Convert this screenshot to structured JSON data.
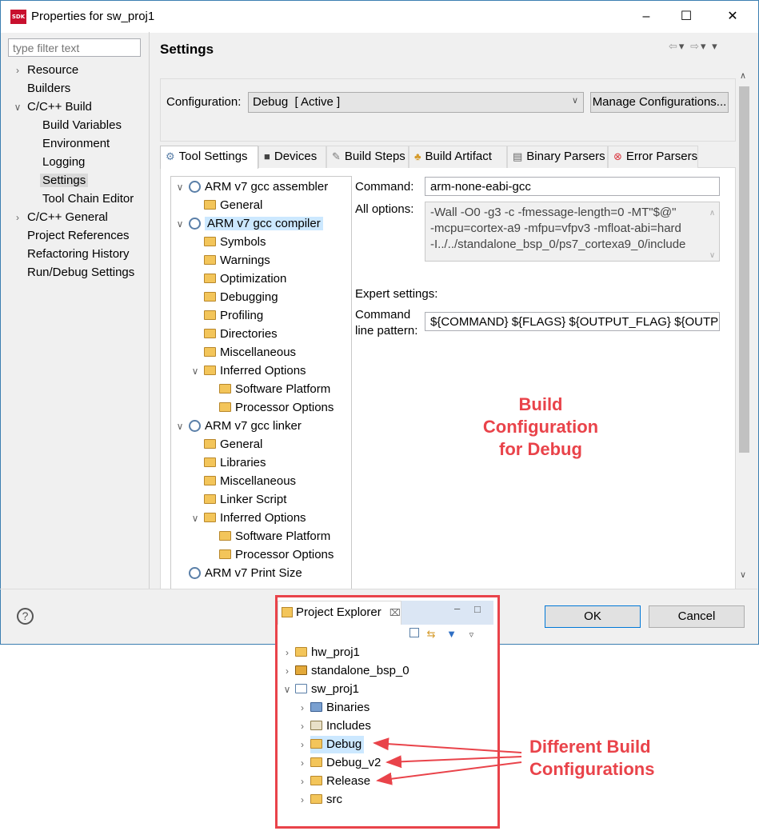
{
  "window": {
    "title": "Properties for sw_proj1",
    "icon_text": "SDK",
    "controls": [
      "minimize-icon",
      "maximize-icon",
      "close-icon"
    ]
  },
  "filter": {
    "placeholder": "type filter text"
  },
  "left_tree": [
    {
      "label": "Resource",
      "expander": "collapsed"
    },
    {
      "label": "Builders",
      "expander": "none"
    },
    {
      "label": "C/C++ Build",
      "expander": "expanded"
    },
    {
      "label": "Build Variables",
      "expander": "none"
    },
    {
      "label": "Environment",
      "expander": "none"
    },
    {
      "label": "Logging",
      "expander": "none"
    },
    {
      "label": "Settings",
      "expander": "none",
      "selected": true
    },
    {
      "label": "Tool Chain Editor",
      "expander": "none"
    },
    {
      "label": "C/C++ General",
      "expander": "collapsed"
    },
    {
      "label": "Project References",
      "expander": "none"
    },
    {
      "label": "Refactoring History",
      "expander": "none"
    },
    {
      "label": "Run/Debug Settings",
      "expander": "none"
    }
  ],
  "page": {
    "title": "Settings",
    "nav_icons": [
      "back-arrow-icon",
      "dropdown-icon",
      "forward-arrow-icon",
      "dropdown-icon",
      "view-menu-icon"
    ]
  },
  "configuration": {
    "label": "Configuration:",
    "value": "Debug  [ Active ]",
    "manage_button": "Manage Configurations..."
  },
  "tabs": [
    {
      "label": "Tool Settings",
      "icon": "tool-settings-icon",
      "active": true
    },
    {
      "label": "Devices",
      "icon": "devices-icon"
    },
    {
      "label": "Build Steps",
      "icon": "build-steps-icon"
    },
    {
      "label": "Build Artifact",
      "icon": "build-artifact-icon"
    },
    {
      "label": "Binary Parsers",
      "icon": "binary-parsers-icon"
    },
    {
      "label": "Error Parsers",
      "icon": "error-parsers-icon"
    }
  ],
  "tool_tree": [
    {
      "label": "ARM v7 gcc assembler",
      "icon": "tool-icon",
      "expander": "expanded"
    },
    {
      "label": "General",
      "icon": "options-folder-icon"
    },
    {
      "label": "ARM v7 gcc compiler",
      "icon": "tool-icon",
      "expander": "expanded",
      "selected": true
    },
    {
      "label": "Symbols",
      "icon": "options-folder-icon"
    },
    {
      "label": "Warnings",
      "icon": "options-folder-icon"
    },
    {
      "label": "Optimization",
      "icon": "options-folder-icon"
    },
    {
      "label": "Debugging",
      "icon": "options-folder-icon"
    },
    {
      "label": "Profiling",
      "icon": "options-folder-icon"
    },
    {
      "label": "Directories",
      "icon": "options-folder-icon"
    },
    {
      "label": "Miscellaneous",
      "icon": "options-folder-icon"
    },
    {
      "label": "Inferred Options",
      "icon": "options-folder-icon",
      "expander": "expanded"
    },
    {
      "label": "Software Platform",
      "icon": "options-folder-icon"
    },
    {
      "label": "Processor Options",
      "icon": "options-folder-icon"
    },
    {
      "label": "ARM v7 gcc linker",
      "icon": "tool-icon",
      "expander": "expanded"
    },
    {
      "label": "General",
      "icon": "options-folder-icon"
    },
    {
      "label": "Libraries",
      "icon": "options-folder-icon"
    },
    {
      "label": "Miscellaneous",
      "icon": "options-folder-icon"
    },
    {
      "label": "Linker Script",
      "icon": "options-folder-icon"
    },
    {
      "label": "Inferred Options",
      "icon": "options-folder-icon",
      "expander": "expanded"
    },
    {
      "label": "Software Platform",
      "icon": "options-folder-icon"
    },
    {
      "label": "Processor Options",
      "icon": "options-folder-icon"
    },
    {
      "label": "ARM v7 Print Size",
      "icon": "tool-icon"
    }
  ],
  "command": {
    "label": "Command:",
    "value": "arm-none-eabi-gcc"
  },
  "all_options": {
    "label": "All options:",
    "lines": [
      "-Wall -O0 -g3 -c -fmessage-length=0 -MT\"$@\"",
      "-mcpu=cortex-a9 -mfpu=vfpv3 -mfloat-abi=hard",
      "-I../../standalone_bsp_0/ps7_cortexa9_0/include"
    ]
  },
  "expert": {
    "heading": "Expert settings:",
    "pattern_label_1": "Command",
    "pattern_label_2": "line pattern:",
    "pattern_value": "${COMMAND} ${FLAGS} ${OUTPUT_FLAG} ${OUTPUT_P"
  },
  "annotation_debug": [
    "Build",
    "Configuration",
    "for Debug"
  ],
  "dialog_buttons": {
    "ok": "OK",
    "cancel": "Cancel"
  },
  "project_explorer": {
    "tab_label": "Project Explorer",
    "items": [
      {
        "label": "hw_proj1",
        "icon": "hw-project-icon",
        "expander": "collapsed"
      },
      {
        "label": "standalone_bsp_0",
        "icon": "bsp-project-icon",
        "expander": "collapsed"
      },
      {
        "label": "sw_proj1",
        "icon": "c-project-icon",
        "expander": "expanded"
      },
      {
        "label": "Binaries",
        "icon": "binaries-icon",
        "expander": "collapsed"
      },
      {
        "label": "Includes",
        "icon": "includes-icon",
        "expander": "collapsed"
      },
      {
        "label": "Debug",
        "icon": "folder-icon",
        "expander": "collapsed",
        "selected": true
      },
      {
        "label": "Debug_v2",
        "icon": "folder-icon",
        "expander": "collapsed"
      },
      {
        "label": "Release",
        "icon": "folder-icon",
        "expander": "collapsed"
      },
      {
        "label": "src",
        "icon": "folder-icon",
        "expander": "collapsed"
      }
    ]
  },
  "annotation_configs": [
    "Different Build",
    "Configurations"
  ],
  "colors": {
    "annotation": "#e9434a",
    "selection": "#cce8ff",
    "accent": "#0078d7"
  }
}
